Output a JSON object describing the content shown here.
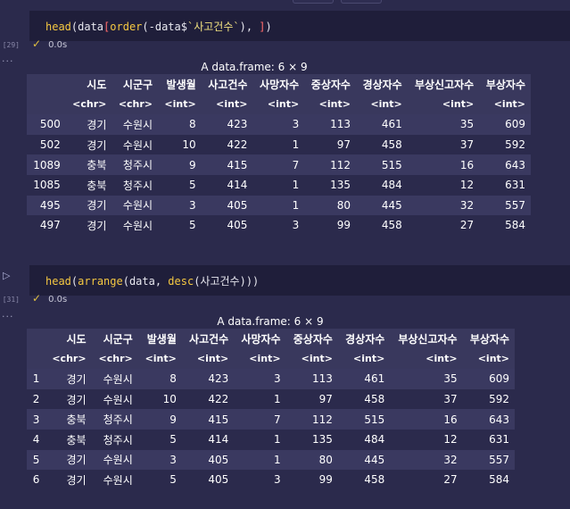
{
  "cells": [
    {
      "exec_count": "[29]",
      "code": {
        "fn": "head",
        "p1": "(data",
        "b1": "[",
        "fn2": "order",
        "p2": "(-data$",
        "s": "`사고건수`",
        "p3": "), ",
        "b2": "]",
        "p4": ")"
      },
      "status_time": "0.0s",
      "output": {
        "caption": "A data.frame: 6 × 9",
        "columns": [
          "",
          "시도",
          "시군구",
          "발생월",
          "사고건수",
          "사망자수",
          "중상자수",
          "경상자수",
          "부상신고자수",
          "부상자수"
        ],
        "types": [
          "",
          "<chr>",
          "<chr>",
          "<int>",
          "<int>",
          "<int>",
          "<int>",
          "<int>",
          "<int>",
          "<int>"
        ],
        "rows": [
          [
            "500",
            "경기",
            "수원시",
            "8",
            "423",
            "3",
            "113",
            "461",
            "35",
            "609"
          ],
          [
            "502",
            "경기",
            "수원시",
            "10",
            "422",
            "1",
            "97",
            "458",
            "37",
            "592"
          ],
          [
            "1089",
            "충북",
            "청주시",
            "9",
            "415",
            "7",
            "112",
            "515",
            "16",
            "643"
          ],
          [
            "1085",
            "충북",
            "청주시",
            "5",
            "414",
            "1",
            "135",
            "484",
            "12",
            "631"
          ],
          [
            "495",
            "경기",
            "수원시",
            "3",
            "405",
            "1",
            "80",
            "445",
            "32",
            "557"
          ],
          [
            "497",
            "경기",
            "수원시",
            "5",
            "405",
            "3",
            "99",
            "458",
            "27",
            "584"
          ]
        ]
      }
    },
    {
      "exec_count": "[31]",
      "code": {
        "fn": "head",
        "p1": "(",
        "fn2": "arrange",
        "p2": "(data, ",
        "fn3": "desc",
        "p3": "(사고건수)))"
      },
      "status_time": "0.0s",
      "output": {
        "caption": "A data.frame: 6 × 9",
        "columns": [
          "",
          "시도",
          "시군구",
          "발생월",
          "사고건수",
          "사망자수",
          "중상자수",
          "경상자수",
          "부상신고자수",
          "부상자수"
        ],
        "types": [
          "",
          "<chr>",
          "<chr>",
          "<int>",
          "<int>",
          "<int>",
          "<int>",
          "<int>",
          "<int>",
          "<int>"
        ],
        "rows": [
          [
            "1",
            "경기",
            "수원시",
            "8",
            "423",
            "3",
            "113",
            "461",
            "35",
            "609"
          ],
          [
            "2",
            "경기",
            "수원시",
            "10",
            "422",
            "1",
            "97",
            "458",
            "37",
            "592"
          ],
          [
            "3",
            "충북",
            "청주시",
            "9",
            "415",
            "7",
            "112",
            "515",
            "16",
            "643"
          ],
          [
            "4",
            "충북",
            "청주시",
            "5",
            "414",
            "1",
            "135",
            "484",
            "12",
            "631"
          ],
          [
            "5",
            "경기",
            "수원시",
            "3",
            "405",
            "1",
            "80",
            "445",
            "32",
            "557"
          ],
          [
            "6",
            "경기",
            "수원시",
            "5",
            "405",
            "3",
            "99",
            "458",
            "27",
            "584"
          ]
        ]
      }
    }
  ],
  "icons": {
    "status": "check-icon",
    "more": "more-dots-icon",
    "run": "run-triangle-icon"
  },
  "colors": {
    "background": "#2b2a4c",
    "code_background": "#1f1e3a",
    "function": "#f5c842",
    "bracket": "#ff6b6b",
    "check": "#e0c040"
  }
}
